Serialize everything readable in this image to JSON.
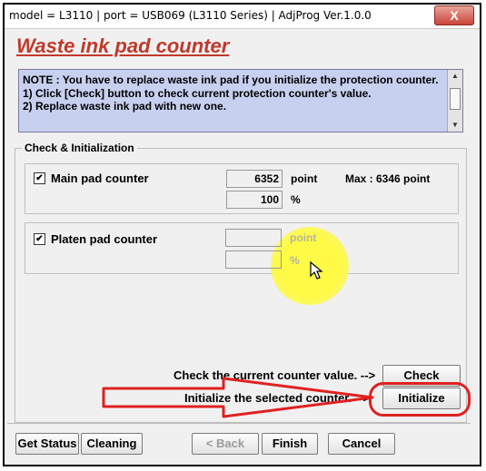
{
  "window": {
    "title": "model = L3110 | port = USB069 (L3110 Series) | AdjProg Ver.1.0.0",
    "close_label": "X"
  },
  "heading": "Waste ink pad counter",
  "note": {
    "text": "NOTE : You have to replace waste ink pad if you initialize the protection counter.\n1) Click [Check] button to check current protection counter's value.\n2) Replace waste ink pad with new one."
  },
  "group": {
    "label": "Check & Initialization",
    "main_pad": {
      "label": "Main pad counter",
      "checked": "✔",
      "point_value": "6352",
      "point_unit": "point",
      "max_label": "Max : 6346 point",
      "percent_value": "100",
      "percent_unit": "%"
    },
    "platen_pad": {
      "label": "Platen pad counter",
      "checked": "✔",
      "point_value": "",
      "point_unit": "point",
      "percent_value": "",
      "percent_unit": "%"
    },
    "check_hint": "Check the current counter value. -->",
    "check_button": "Check",
    "init_hint": "Initialize the selected counter. -->",
    "init_button": "Initialize"
  },
  "footer": {
    "get_status": "Get Status",
    "cleaning": "Cleaning",
    "back": "< Back",
    "finish": "Finish",
    "cancel": "Cancel"
  },
  "colors": {
    "heading": "#c0392b",
    "note_bg": "#c8d0f0",
    "annotation_red": "#e02020",
    "cursor_highlight": "#fff83c"
  }
}
